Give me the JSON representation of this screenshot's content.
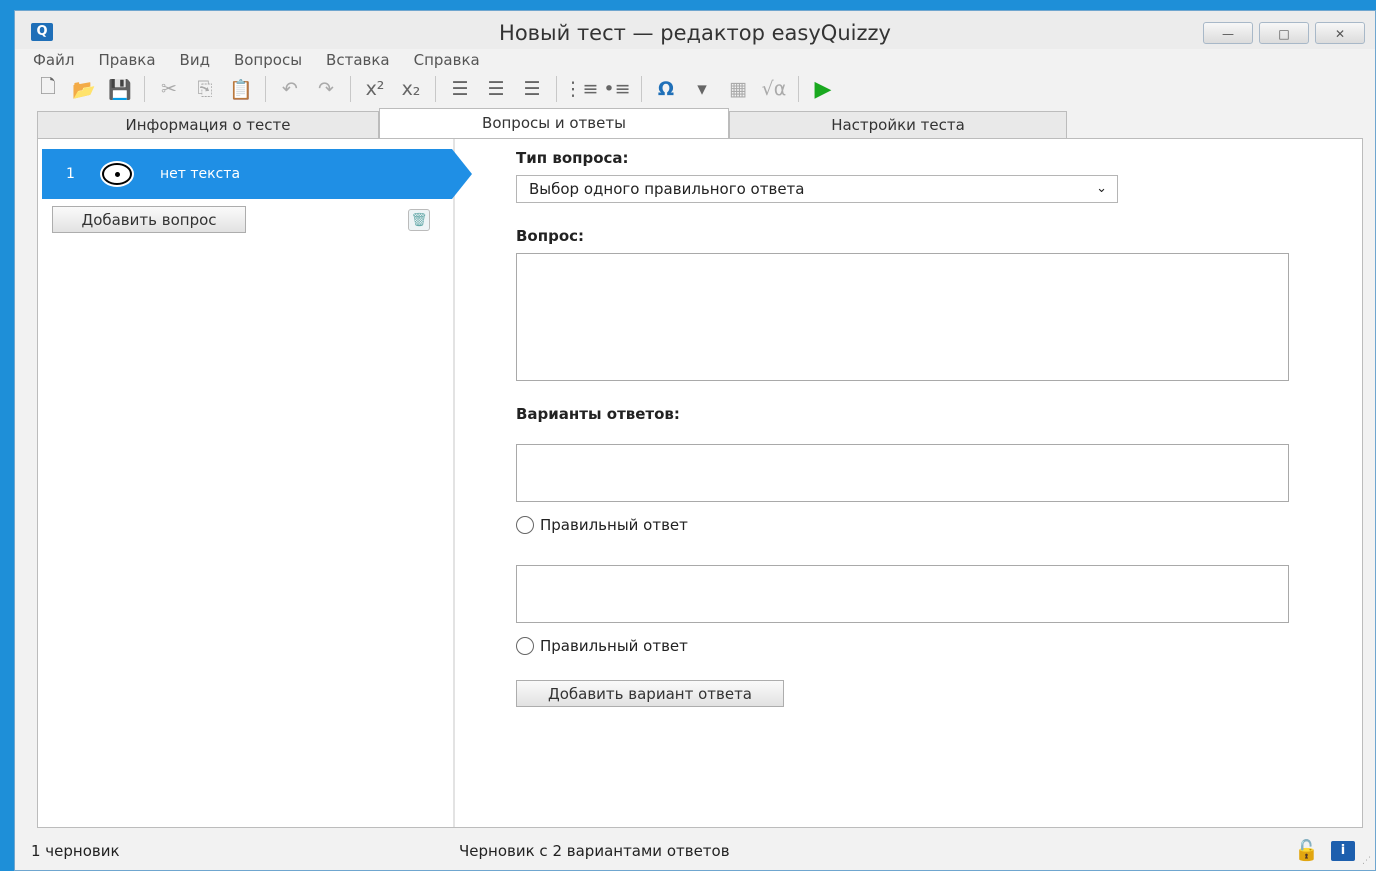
{
  "window": {
    "app_icon": "Q",
    "title": "Новый тест — редактор easyQuizzy",
    "controls": {
      "minimize": "—",
      "maximize": "□",
      "close": "✕"
    }
  },
  "menu": [
    "Файл",
    "Правка",
    "Вид",
    "Вопросы",
    "Вставка",
    "Справка"
  ],
  "toolbar": [
    {
      "name": "new-file-icon",
      "glyph": "🗋"
    },
    {
      "name": "open-folder-icon",
      "glyph": "📂"
    },
    {
      "name": "save-icon",
      "glyph": "💾"
    },
    {
      "name": "sep"
    },
    {
      "name": "cut-icon",
      "glyph": "✂"
    },
    {
      "name": "copy-icon",
      "glyph": "⎘"
    },
    {
      "name": "paste-icon",
      "glyph": "📋"
    },
    {
      "name": "sep"
    },
    {
      "name": "undo-icon",
      "glyph": "↶"
    },
    {
      "name": "redo-icon",
      "glyph": "↷"
    },
    {
      "name": "sep"
    },
    {
      "name": "superscript-icon",
      "glyph": "x²"
    },
    {
      "name": "subscript-icon",
      "glyph": "x₂"
    },
    {
      "name": "sep"
    },
    {
      "name": "align-left-icon",
      "glyph": "☰"
    },
    {
      "name": "align-center-icon",
      "glyph": "☰"
    },
    {
      "name": "align-right-icon",
      "glyph": "☰"
    },
    {
      "name": "sep"
    },
    {
      "name": "numbered-list-icon",
      "glyph": "⋮≡"
    },
    {
      "name": "bullet-list-icon",
      "glyph": "•≡"
    },
    {
      "name": "sep"
    },
    {
      "name": "special-char-icon",
      "glyph": "Ω"
    },
    {
      "name": "dropdown-arrow-icon",
      "glyph": "▾"
    },
    {
      "name": "insert-image-icon",
      "glyph": "▦"
    },
    {
      "name": "formula-icon",
      "glyph": "√α"
    },
    {
      "name": "sep"
    },
    {
      "name": "run-test-icon",
      "glyph": "▶"
    }
  ],
  "tabs": [
    "Информация о тесте",
    "Вопросы и ответы",
    "Настройки теста"
  ],
  "active_tab": 1,
  "question_list": {
    "items": [
      {
        "number": "1",
        "text": "нет текста"
      }
    ],
    "add_button": "Добавить вопрос"
  },
  "form": {
    "type_label": "Тип вопроса:",
    "type_value": "Выбор одного правильного ответа",
    "question_label": "Вопрос:",
    "answers_label": "Варианты ответов:",
    "correct_label": "Правильный ответ",
    "add_answer_button": "Добавить вариант ответа"
  },
  "status": {
    "left": "1 черновик",
    "middle": "Черновик с 2 вариантами ответов"
  }
}
